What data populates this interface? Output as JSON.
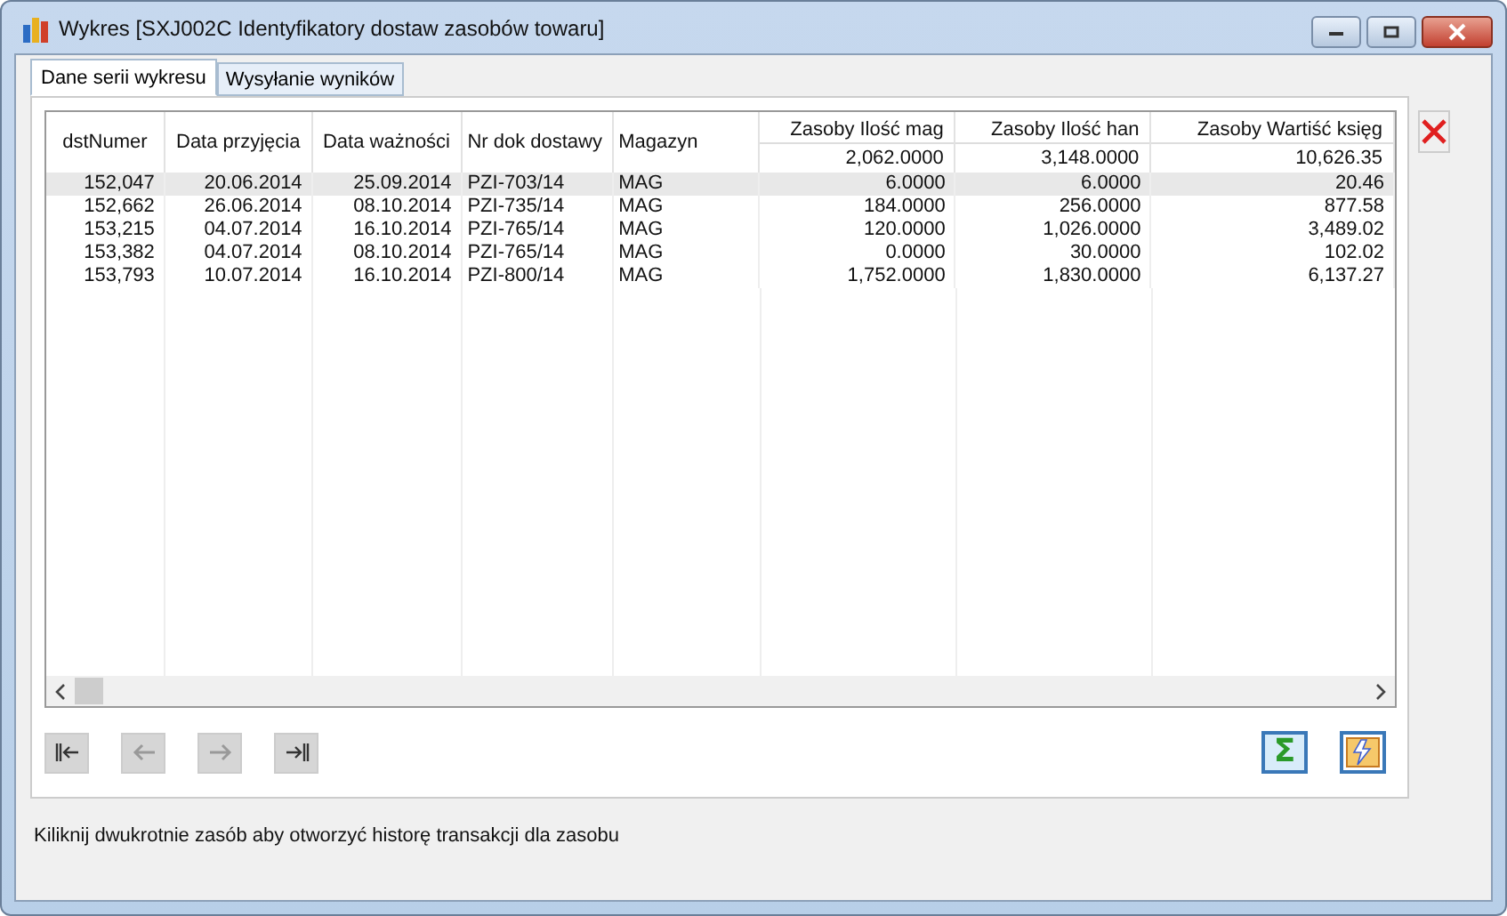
{
  "window": {
    "title": "Wykres [SXJ002C Identyfikatory dostaw zasobów towaru]"
  },
  "tabs": [
    {
      "label": "Dane serii wykresu",
      "selected": true
    },
    {
      "label": "Wysyłanie wyników",
      "selected": false
    }
  ],
  "table": {
    "columns": [
      {
        "label": "dstNumer",
        "kind": "number"
      },
      {
        "label": "Data przyjęcia",
        "kind": "date"
      },
      {
        "label": "Data ważności",
        "kind": "date"
      },
      {
        "label": "Nr dok dostawy",
        "kind": "text"
      },
      {
        "label": "Magazyn",
        "kind": "text"
      },
      {
        "label": "Zasoby Ilość mag",
        "total": "2,062.0000",
        "kind": "number"
      },
      {
        "label": "Zasoby Ilość han",
        "total": "3,148.0000",
        "kind": "number"
      },
      {
        "label": "Zasoby Wartiść księg",
        "total": "10,626.35",
        "kind": "number"
      }
    ],
    "rows": [
      {
        "selected": true,
        "cells": [
          "152,047",
          "20.06.2014",
          "25.09.2014",
          "PZI-703/14",
          "MAG",
          "6.0000",
          "6.0000",
          "20.46"
        ]
      },
      {
        "selected": false,
        "cells": [
          "152,662",
          "26.06.2014",
          "08.10.2014",
          "PZI-735/14",
          "MAG",
          "184.0000",
          "256.0000",
          "877.58"
        ]
      },
      {
        "selected": false,
        "cells": [
          "153,215",
          "04.07.2014",
          "16.10.2014",
          "PZI-765/14",
          "MAG",
          "120.0000",
          "1,026.0000",
          "3,489.02"
        ]
      },
      {
        "selected": false,
        "cells": [
          "153,382",
          "04.07.2014",
          "08.10.2014",
          "PZI-765/14",
          "MAG",
          "0.0000",
          "30.0000",
          "102.02"
        ]
      },
      {
        "selected": false,
        "cells": [
          "153,793",
          "10.07.2014",
          "16.10.2014",
          "PZI-800/14",
          "MAG",
          "1,752.0000",
          "1,830.0000",
          "6,137.27"
        ]
      }
    ]
  },
  "sum_button": {
    "label": "Σ",
    "on": true
  },
  "status_bar": "Kiliknij dwukrotnie zasób aby otworzyć historę transakcji dla zasobu"
}
